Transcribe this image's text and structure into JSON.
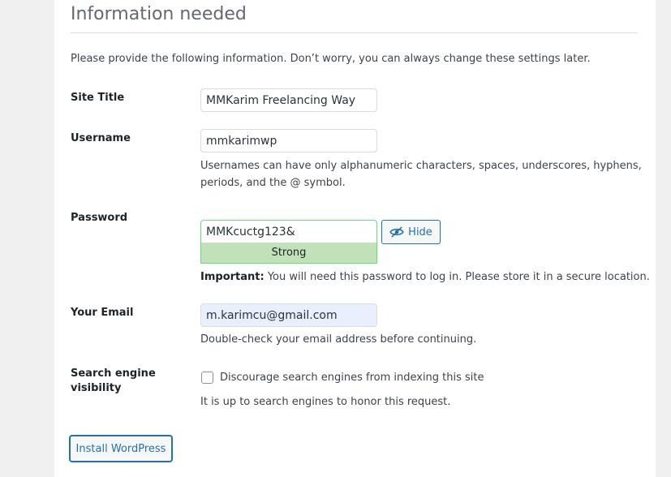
{
  "page": {
    "heading": "Information needed",
    "intro": "Please provide the following information. Don’t worry, you can always change these settings later."
  },
  "site_title": {
    "label": "Site Title",
    "value": "MMKarim Freelancing Way"
  },
  "username": {
    "label": "Username",
    "value": "mmkarimwp",
    "help_line1": "Usernames can have only alphanumeric characters, spaces, underscores, hyphens,",
    "help_line2": "periods, and the @ symbol."
  },
  "password": {
    "label": "Password",
    "value": "MMKcuctg123&",
    "hide_label": "Hide",
    "hide_icon": "eye-slash-icon",
    "strength": "Strength indicator",
    "strength_text": "Strong",
    "strength_color": "#c1e1b9",
    "important_label": "Important:",
    "important_text": " You will need this password to log in. Please store it in a secure location."
  },
  "email": {
    "label": "Your Email",
    "value": "m.karimcu@gmail.com",
    "help": "Double-check your email address before continuing."
  },
  "visibility": {
    "label_line1": "Search engine",
    "label_line2": "visibility",
    "checkbox_label": "Discourage search engines from indexing this site",
    "checked": false,
    "help": "It is up to search engines to honor this request."
  },
  "actions": {
    "install_label": "Install WordPress",
    "accent_color": "#2271b1"
  }
}
